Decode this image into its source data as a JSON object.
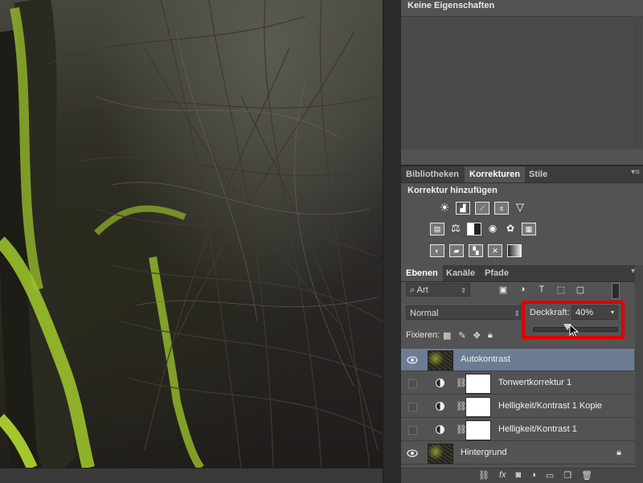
{
  "properties_panel": {
    "title": "Keine Eigenschaften"
  },
  "adjustments_tabs": {
    "tabs": [
      {
        "label": "Bibliotheken",
        "active": false
      },
      {
        "label": "Korrekturen",
        "active": true
      },
      {
        "label": "Stile",
        "active": false
      }
    ],
    "section_title": "Korrektur hinzufügen",
    "icons_row1": [
      "brightness-contrast-icon",
      "levels-icon",
      "curves-icon",
      "exposure-icon",
      "vibrance-icon"
    ],
    "icons_row2": [
      "hue-saturation-icon",
      "color-balance-icon",
      "black-white-icon",
      "photo-filter-icon",
      "channel-mixer-icon",
      "color-lookup-icon"
    ],
    "icons_row3": [
      "invert-icon",
      "posterize-icon",
      "threshold-icon",
      "selective-color-icon",
      "gradient-map-icon"
    ]
  },
  "layers_panel": {
    "tabs": [
      {
        "label": "Ebenen",
        "active": true
      },
      {
        "label": "Kanäle",
        "active": false
      },
      {
        "label": "Pfade",
        "active": false
      }
    ],
    "filter_label": "Art",
    "blend_mode": "Normal",
    "opacity_label": "Deckkraft:",
    "opacity_value": "40%",
    "opacity_percent": 40,
    "fix_label": "Fixieren:",
    "layers": [
      {
        "name": "Autokontrast",
        "visible": true,
        "selected": true,
        "type": "pixel"
      },
      {
        "name": "Tonwertkorrektur 1",
        "visible": false,
        "selected": false,
        "type": "adjustment"
      },
      {
        "name": "Helligkeit/Kontrast 1 Kopie",
        "visible": false,
        "selected": false,
        "type": "adjustment"
      },
      {
        "name": "Helligkeit/Kontrast 1",
        "visible": false,
        "selected": false,
        "type": "adjustment"
      },
      {
        "name": "Hintergrund",
        "visible": true,
        "selected": false,
        "type": "background",
        "locked": true
      }
    ],
    "bottom_icons": [
      "link-icon",
      "fx-icon",
      "mask-icon",
      "adjustment-layer-icon",
      "group-icon",
      "new-layer-icon",
      "trash-icon"
    ]
  },
  "colors": {
    "panel_bg": "#535353",
    "selected_layer": "#6d7c93",
    "highlight_box": "#e00000"
  }
}
